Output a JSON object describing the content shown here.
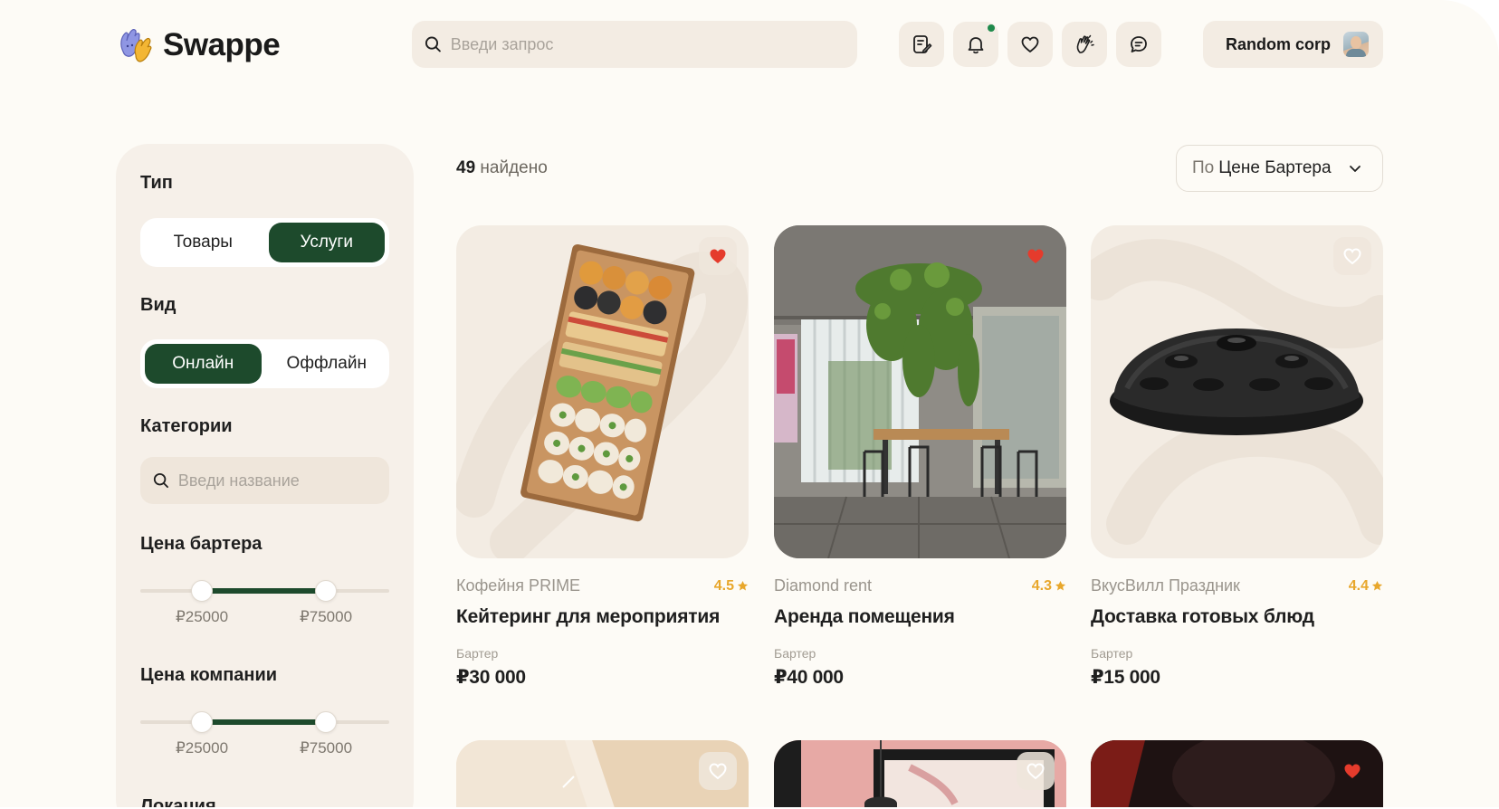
{
  "app": {
    "name": "Swappe"
  },
  "header": {
    "search_placeholder": "Введи запрос",
    "account_name": "Random corp"
  },
  "sidebar": {
    "type": {
      "heading": "Тип",
      "options": [
        "Товары",
        "Услуги"
      ],
      "selected": "Услуги"
    },
    "kind": {
      "heading": "Вид",
      "options": [
        "Онлайн",
        "Оффлайн"
      ],
      "selected": "Онлайн"
    },
    "categories": {
      "heading": "Категории",
      "placeholder": "Введи название"
    },
    "barter_price": {
      "heading": "Цена бартера",
      "min_label": "₽25000",
      "max_label": "₽75000",
      "min_value": 25000,
      "max_value": 75000
    },
    "company_price": {
      "heading": "Цена компании",
      "min_label": "₽25000",
      "max_label": "₽75000",
      "min_value": 25000,
      "max_value": 75000
    },
    "location_heading": "Локация"
  },
  "results": {
    "count": "49",
    "count_suffix": "найдено",
    "sort_prefix": "По",
    "sort_value": "Цене Бартера"
  },
  "cards": [
    {
      "seller": "Кофейня PRIME",
      "rating": "4.5",
      "title": "Кейтеринг для мероприятия",
      "price_label": "Бартер",
      "price": "₽30 000",
      "favorited": true,
      "image": "catering-box"
    },
    {
      "seller": "Diamond rent",
      "rating": "4.3",
      "title": "Аренда помещения",
      "price_label": "Бартер",
      "price": "₽40 000",
      "favorited": true,
      "image": "office-room"
    },
    {
      "seller": "ВкусВилл Праздник",
      "rating": "4.4",
      "title": "Доставка готовых блюд",
      "price_label": "Бартер",
      "price": "₽15 000",
      "favorited": false,
      "image": "handpan"
    }
  ],
  "bottom_cards": [
    {
      "favorited": false,
      "image": "box"
    },
    {
      "favorited": false,
      "image": "lamp-room"
    },
    {
      "favorited": true,
      "image": "dark-photo"
    }
  ],
  "colors": {
    "background": "#fdfbf6",
    "accent_green": "#1d4a2c",
    "favorite_red": "#e53b2c",
    "rating_orange": "#e8a72c",
    "notification_dot": "#1f8a4c"
  },
  "icons": [
    "search-icon",
    "orders-icon",
    "bell-icon",
    "heart-icon",
    "clap-hands-icon",
    "chat-icon",
    "chevron-down-icon",
    "star-icon"
  ]
}
